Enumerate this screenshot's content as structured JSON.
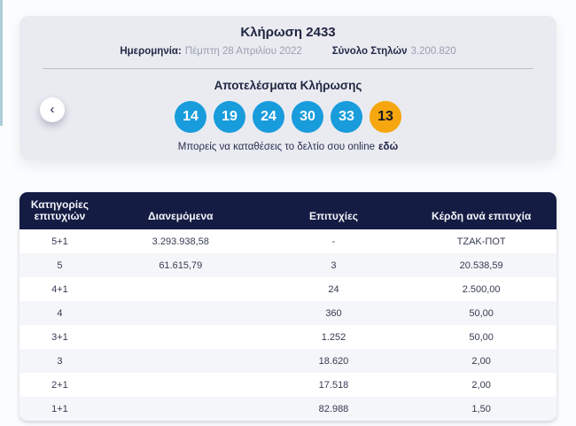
{
  "panel": {
    "title": "Κλήρωση 2433",
    "date_label": "Ημερομηνία:",
    "date_value": "Πέμπτη 28 Απριλίου 2022",
    "totals_label": "Σύνολο Στηλών",
    "totals_value": "3.200.820",
    "results_heading": "Αποτελέσματα Κλήρωσης",
    "winning_numbers": [
      "14",
      "19",
      "24",
      "30",
      "33"
    ],
    "bonus_number": "13",
    "online_prefix": "Μπορείς να καταθέσεις το δελτίο σου online",
    "online_link_label": "εδώ"
  },
  "icons": {
    "chevron_left": "‹"
  },
  "table": {
    "headers": [
      "Κατηγορίες επιτυχιών",
      "Διανεμόμενα",
      "Επιτυχίες",
      "Κέρδη ανά επιτυχία"
    ],
    "rows": [
      {
        "category": "5+1",
        "distributed": "3.293.938,58",
        "winners": "-",
        "prize": "ΤΖΑΚ-ΠΟΤ"
      },
      {
        "category": "5",
        "distributed": "61.615,79",
        "winners": "3",
        "prize": "20.538,59"
      },
      {
        "category": "4+1",
        "distributed": "",
        "winners": "24",
        "prize": "2.500,00"
      },
      {
        "category": "4",
        "distributed": "",
        "winners": "360",
        "prize": "50,00"
      },
      {
        "category": "3+1",
        "distributed": "",
        "winners": "1.252",
        "prize": "50,00"
      },
      {
        "category": "3",
        "distributed": "",
        "winners": "18.620",
        "prize": "2,00"
      },
      {
        "category": "2+1",
        "distributed": "",
        "winners": "17.518",
        "prize": "2,00"
      },
      {
        "category": "1+1",
        "distributed": "",
        "winners": "82.988",
        "prize": "1,50"
      }
    ]
  },
  "colors": {
    "ball_blue": "#189cdc",
    "ball_bonus_orange": "#f6a60e",
    "table_header_navy": "#151c44",
    "panel_background": "#e9ebf1",
    "accent_strip": "#aecdd8"
  }
}
